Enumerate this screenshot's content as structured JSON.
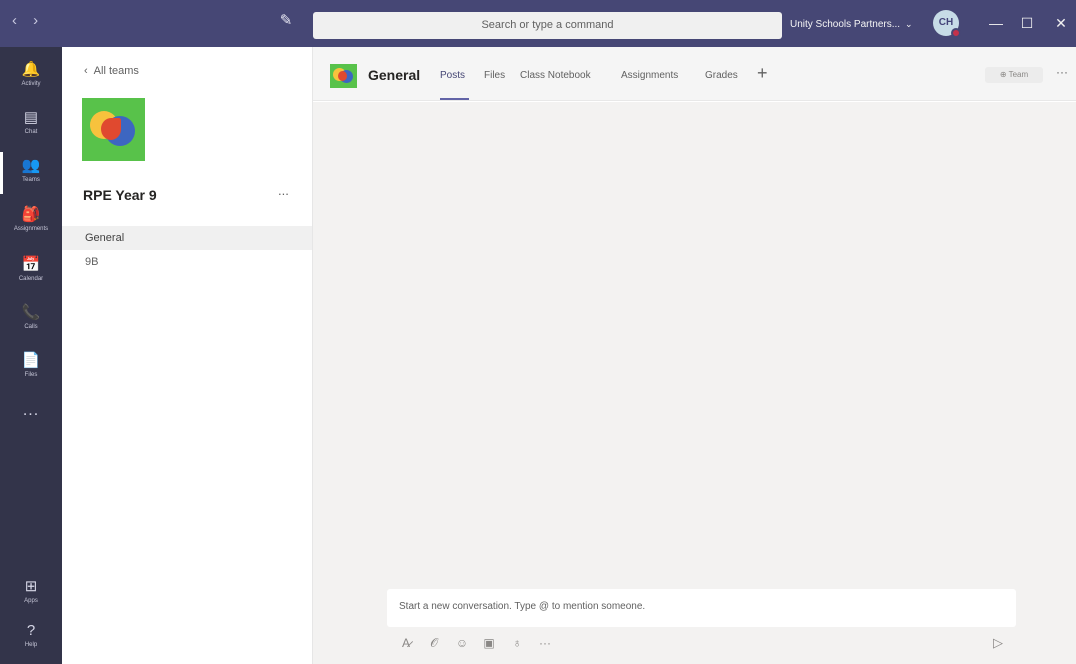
{
  "titlebar": {
    "nav_label": "‹ ›",
    "compose_icon": "✎",
    "search_placeholder": "Search or type a command",
    "org_name": "Unity Schools Partners...",
    "org_caret": "⌄",
    "avatar_initials": "CH",
    "minimize": "—",
    "maximize": "☐",
    "close": "✕"
  },
  "appbar": {
    "items": [
      {
        "glyph": "🔔",
        "label": "Activity"
      },
      {
        "glyph": "▤",
        "label": "Chat"
      },
      {
        "glyph": "👥",
        "label": "Teams"
      },
      {
        "glyph": "🎒",
        "label": "Assignments"
      },
      {
        "glyph": "📅",
        "label": "Calendar"
      },
      {
        "glyph": "📞",
        "label": "Calls"
      },
      {
        "glyph": "📄",
        "label": "Files"
      }
    ],
    "more": "...",
    "bottom_items": [
      {
        "glyph": "⊞",
        "label": "Apps"
      },
      {
        "glyph": "?",
        "label": "Help"
      }
    ]
  },
  "team_panel": {
    "back_label": "All teams",
    "back_chevron": "‹",
    "team_name": "RPE Year 9",
    "more": "...",
    "channels": [
      "General",
      "9B"
    ]
  },
  "header": {
    "channel_title": "General",
    "tabs": [
      "Posts",
      "Files",
      "Class Notebook",
      "Assignments",
      "Grades"
    ],
    "add_tab": "+",
    "team_button": "⊕ Team",
    "more": "···"
  },
  "composer": {
    "placeholder": "Start a new conversation. Type @ to mention someone.",
    "tools": [
      "A̷",
      "𝒪",
      "☺",
      "▣",
      "♁",
      "···"
    ],
    "send": "▷"
  },
  "colors": {
    "titlebar": "#464775",
    "appbar": "#33344a",
    "accent": "#6264a7",
    "content_bg": "#f3f2f1"
  }
}
